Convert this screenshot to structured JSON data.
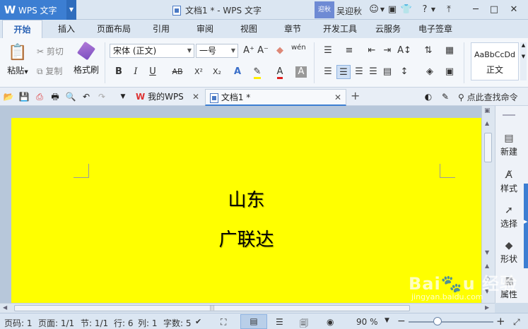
{
  "titlebar": {
    "app_name": "WPS 文字",
    "doc_title": "文档1 * - WPS 文字",
    "user_badge": "迎秋",
    "user_name": "吴迎秋"
  },
  "ribbon_tabs": [
    "开始",
    "插入",
    "页面布局",
    "引用",
    "审阅",
    "视图",
    "章节",
    "开发工具",
    "云服务",
    "电子签章"
  ],
  "ribbon": {
    "paste": "粘贴",
    "cut": "剪切",
    "copy": "复制",
    "format_painter": "格式刷",
    "font_name": "宋体 (正文)",
    "font_size": "一号",
    "style_preview": "AaBbCcDd",
    "style_name": "正文",
    "format_buttons": {
      "bold": "B",
      "italic": "I",
      "underline": "U",
      "strike": "AB",
      "superscript": "X²",
      "subscript": "X₂",
      "font_color": "A"
    },
    "grow": "A⁺",
    "shrink": "A⁻",
    "phonetic": "wén"
  },
  "quickbar": {
    "tabs": [
      "我的WPS",
      "文档1 *"
    ],
    "add_tab": "+",
    "search_placeholder": "点此查找命令"
  },
  "document": {
    "lines": [
      "山东",
      "广联达"
    ],
    "page_color": "#ffff00"
  },
  "taskpane": [
    "新建",
    "样式",
    "选择",
    "形状",
    "属性"
  ],
  "statusbar": {
    "page_code": "页码: 1",
    "page": "页面: 1/1",
    "section": "节: 1/1",
    "row": "行: 6",
    "col": "列: 1",
    "word_count": "字数: 5",
    "zoom": "90 %",
    "zoom_minus": "−",
    "zoom_plus": "+"
  },
  "watermark": "Baidu 经验 jingyan.baidu.com"
}
